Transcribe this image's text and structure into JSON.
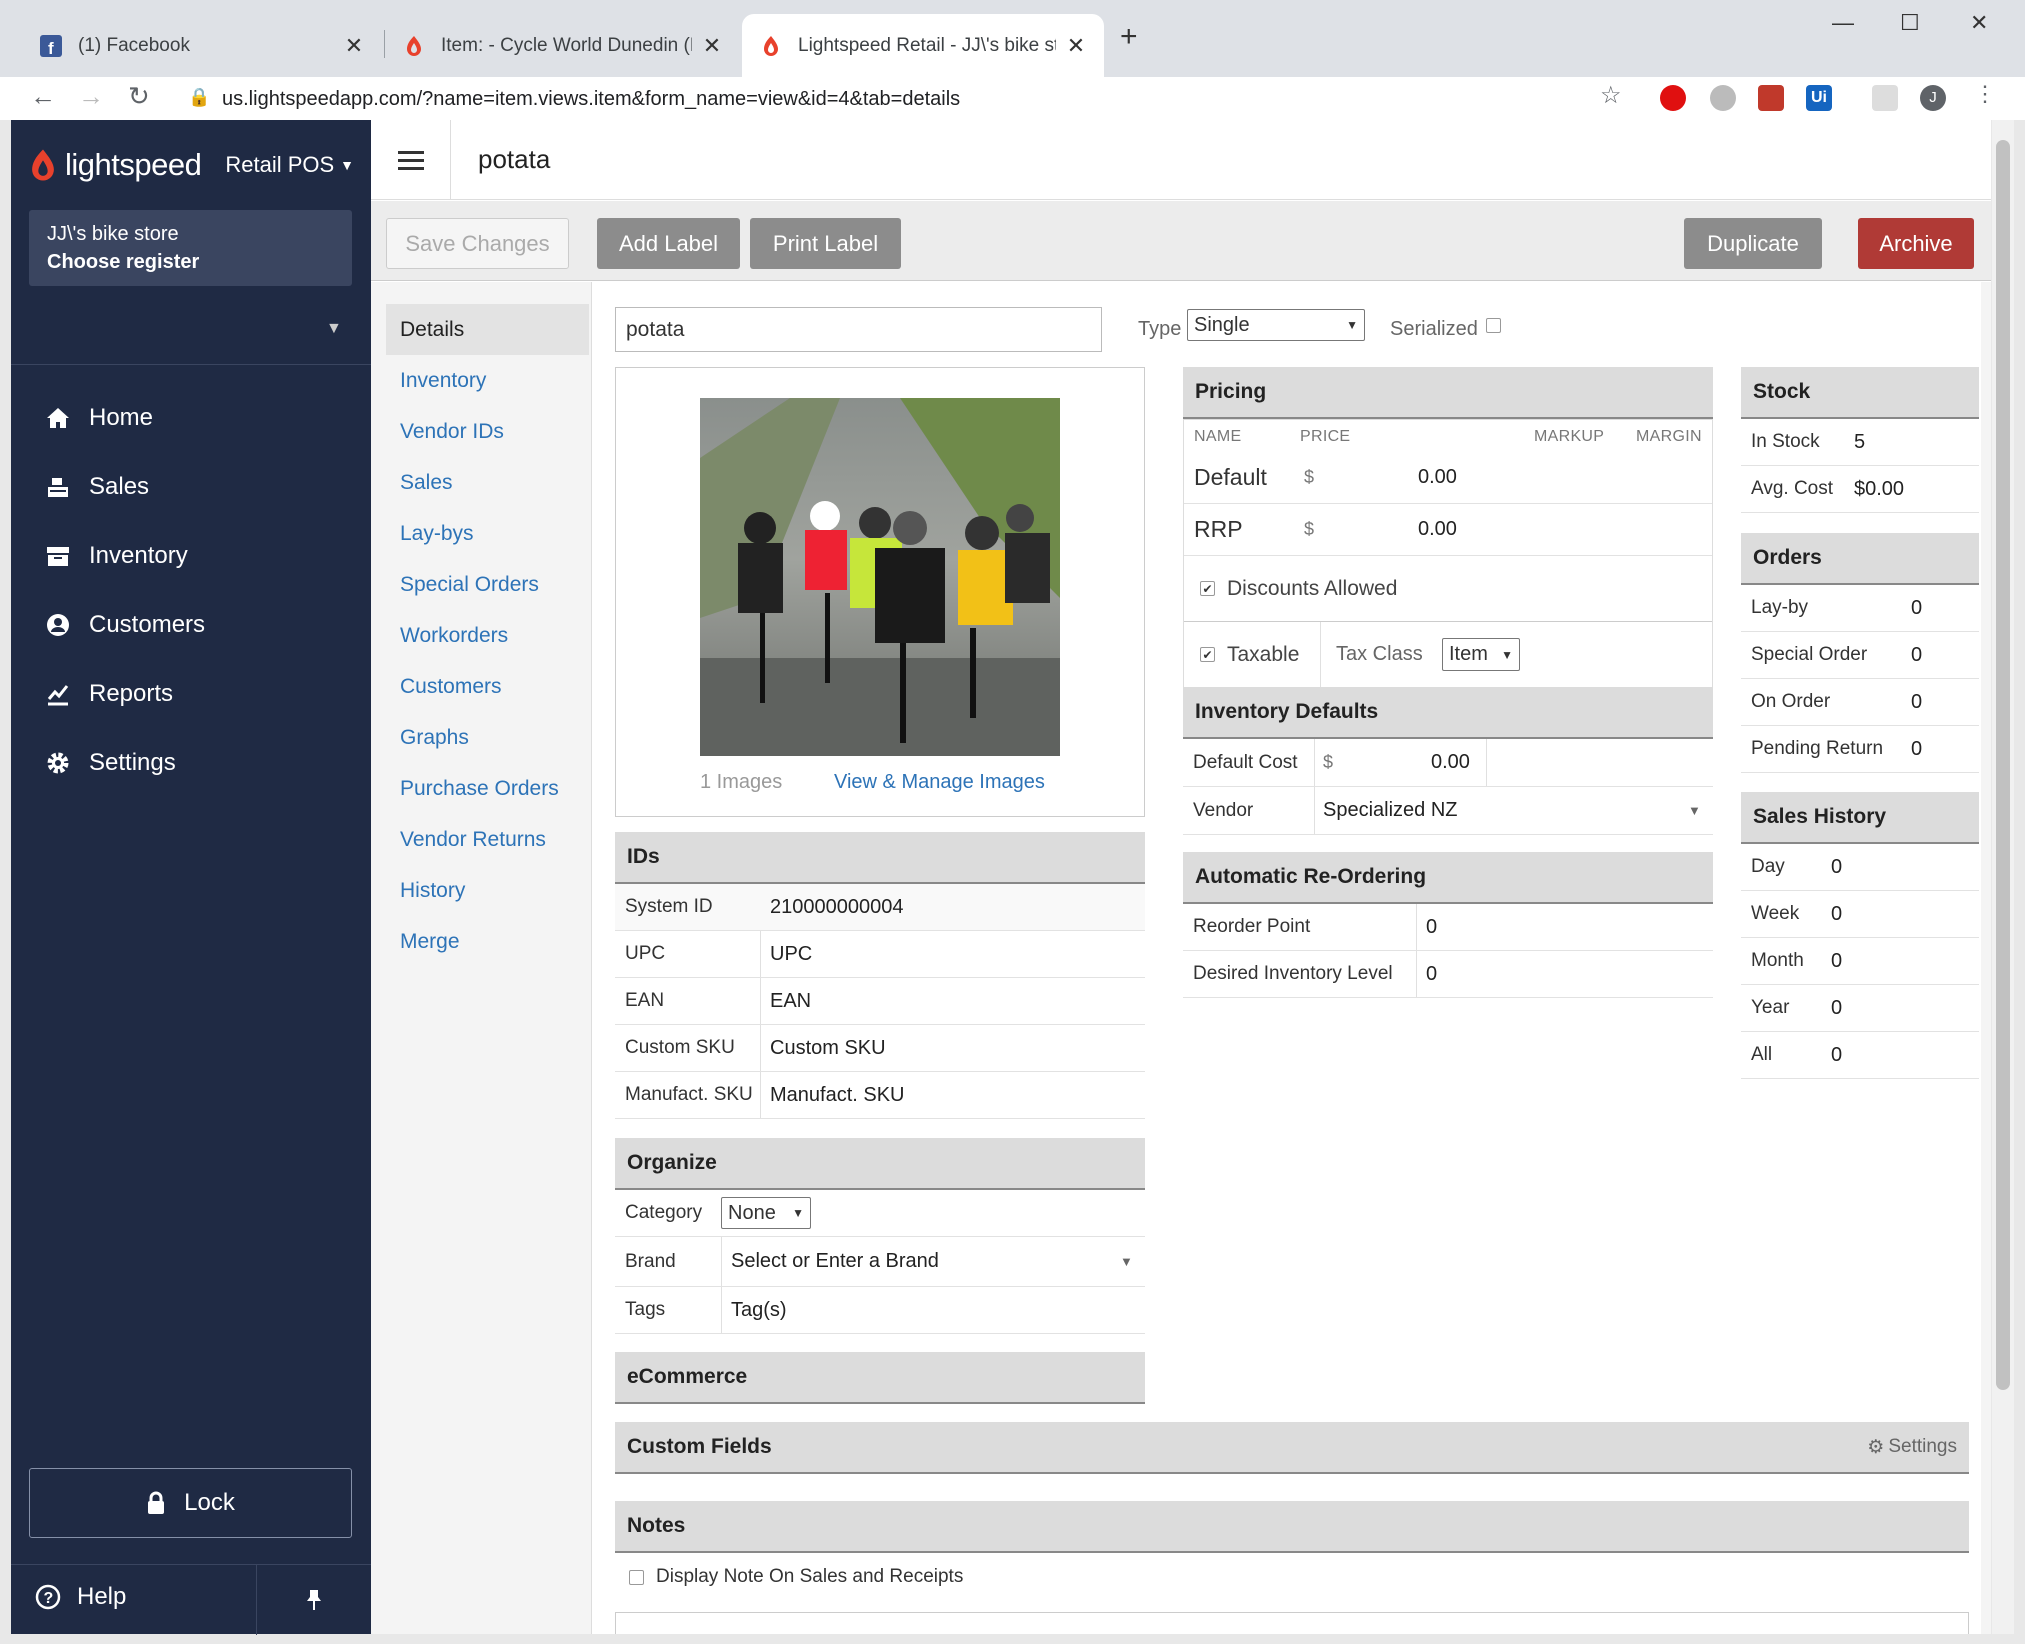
{
  "browser": {
    "tabs": [
      {
        "title": "(1) Facebook"
      },
      {
        "title": "Item: - Cycle World Dunedin (Lig"
      },
      {
        "title": "Lightspeed Retail - JJ\\'s bike store"
      }
    ],
    "url": "us.lightspeedapp.com/?name=item.views.item&form_name=view&id=4&tab=details",
    "profile_initial": "J"
  },
  "sidebar": {
    "brand": "lightspeed",
    "product": "Retail POS",
    "store_name": "JJ\\'s bike store",
    "register": "Choose register",
    "items": [
      {
        "label": "Home",
        "icon": "home-icon"
      },
      {
        "label": "Sales",
        "icon": "register-icon"
      },
      {
        "label": "Inventory",
        "icon": "inventory-icon"
      },
      {
        "label": "Customers",
        "icon": "user-icon"
      },
      {
        "label": "Reports",
        "icon": "chart-icon"
      },
      {
        "label": "Settings",
        "icon": "gear-icon"
      }
    ],
    "lock_label": "Lock",
    "help_label": "Help"
  },
  "header": {
    "title": "potata"
  },
  "toolbar": {
    "save": "Save Changes",
    "add_label": "Add Label",
    "print_label": "Print Label",
    "duplicate": "Duplicate",
    "archive": "Archive"
  },
  "subnav": [
    "Details",
    "Inventory",
    "Vendor IDs",
    "Sales",
    "Lay-bys",
    "Special Orders",
    "Workorders",
    "Customers",
    "Graphs",
    "Purchase Orders",
    "Vendor Returns",
    "History",
    "Merge"
  ],
  "item": {
    "name": "potata",
    "type_label": "Type",
    "type_value": "Single",
    "serialized_label": "Serialized",
    "images_count": "1 Images",
    "manage_images": "View & Manage Images"
  },
  "ids": {
    "title": "IDs",
    "system_id_label": "System ID",
    "system_id": "210000000004",
    "upc_label": "UPC",
    "upc_placeholder": "UPC",
    "ean_label": "EAN",
    "ean_placeholder": "EAN",
    "custom_sku_label": "Custom SKU",
    "custom_sku_placeholder": "Custom SKU",
    "manufact_sku_label": "Manufact. SKU",
    "manufact_sku_placeholder": "Manufact. SKU"
  },
  "organize": {
    "title": "Organize",
    "category_label": "Category",
    "category_value": "None",
    "brand_label": "Brand",
    "brand_placeholder": "Select or Enter a Brand",
    "tags_label": "Tags",
    "tags_placeholder": "Tag(s)"
  },
  "ecommerce": {
    "title": "eCommerce"
  },
  "custom_fields": {
    "title": "Custom Fields",
    "settings": "Settings"
  },
  "notes": {
    "title": "Notes",
    "display_note": "Display Note On Sales and Receipts"
  },
  "pricing": {
    "title": "Pricing",
    "headers": {
      "name": "NAME",
      "price": "PRICE",
      "markup": "MARKUP",
      "margin": "MARGIN"
    },
    "rows": [
      {
        "name": "Default",
        "currency": "$",
        "price": "0.00"
      },
      {
        "name": "RRP",
        "currency": "$",
        "price": "0.00"
      }
    ],
    "discounts_allowed": "Discounts Allowed",
    "taxable": "Taxable",
    "tax_class_label": "Tax Class",
    "tax_class_value": "Item"
  },
  "inventory_defaults": {
    "title": "Inventory Defaults",
    "default_cost_label": "Default Cost",
    "currency": "$",
    "default_cost": "0.00",
    "vendor_label": "Vendor",
    "vendor_value": "Specialized NZ"
  },
  "reordering": {
    "title": "Automatic Re-Ordering",
    "reorder_point_label": "Reorder Point",
    "reorder_point": "0",
    "desired_level_label": "Desired Inventory Level",
    "desired_level": "0"
  },
  "stock": {
    "title": "Stock",
    "in_stock_label": "In Stock",
    "in_stock": "5",
    "avg_cost_label": "Avg. Cost",
    "avg_cost": "$0.00"
  },
  "orders": {
    "title": "Orders",
    "rows": [
      {
        "label": "Lay-by",
        "value": "0"
      },
      {
        "label": "Special Order",
        "value": "0"
      },
      {
        "label": "On Order",
        "value": "0"
      },
      {
        "label": "Pending Return",
        "value": "0"
      }
    ]
  },
  "sales_history": {
    "title": "Sales History",
    "rows": [
      {
        "label": "Day",
        "value": "0"
      },
      {
        "label": "Week",
        "value": "0"
      },
      {
        "label": "Month",
        "value": "0"
      },
      {
        "label": "Year",
        "value": "0"
      },
      {
        "label": "All",
        "value": "0"
      }
    ]
  },
  "colors": {
    "sidebar": "#1f2a44",
    "accent": "#2d73b7",
    "archive": "#b03a36",
    "brand": "#e8412c"
  }
}
